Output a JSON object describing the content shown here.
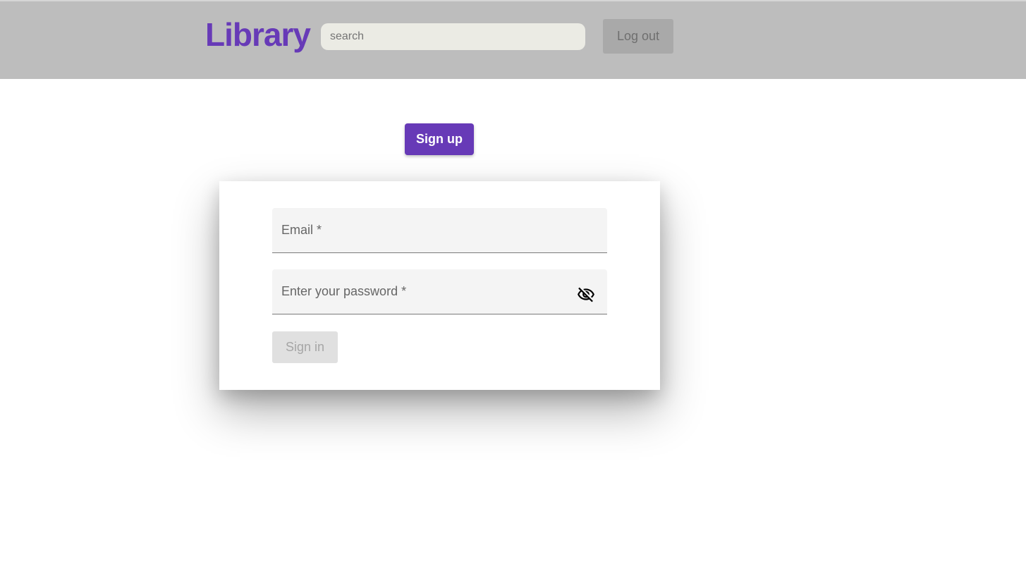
{
  "header": {
    "brand": "Library",
    "search_placeholder": "search",
    "search_value": "",
    "logout_label": "Log out"
  },
  "main": {
    "signup_label": "Sign up",
    "form": {
      "email_label": "Email *",
      "password_label": "Enter your password *",
      "visibility_icon": "visibility-off-icon",
      "signin_label": "Sign in"
    }
  },
  "colors": {
    "brand": "#673ab7",
    "header_bg": "#bdbdbd",
    "search_bg": "#ebebe4",
    "field_bg": "#f4f4f4"
  }
}
